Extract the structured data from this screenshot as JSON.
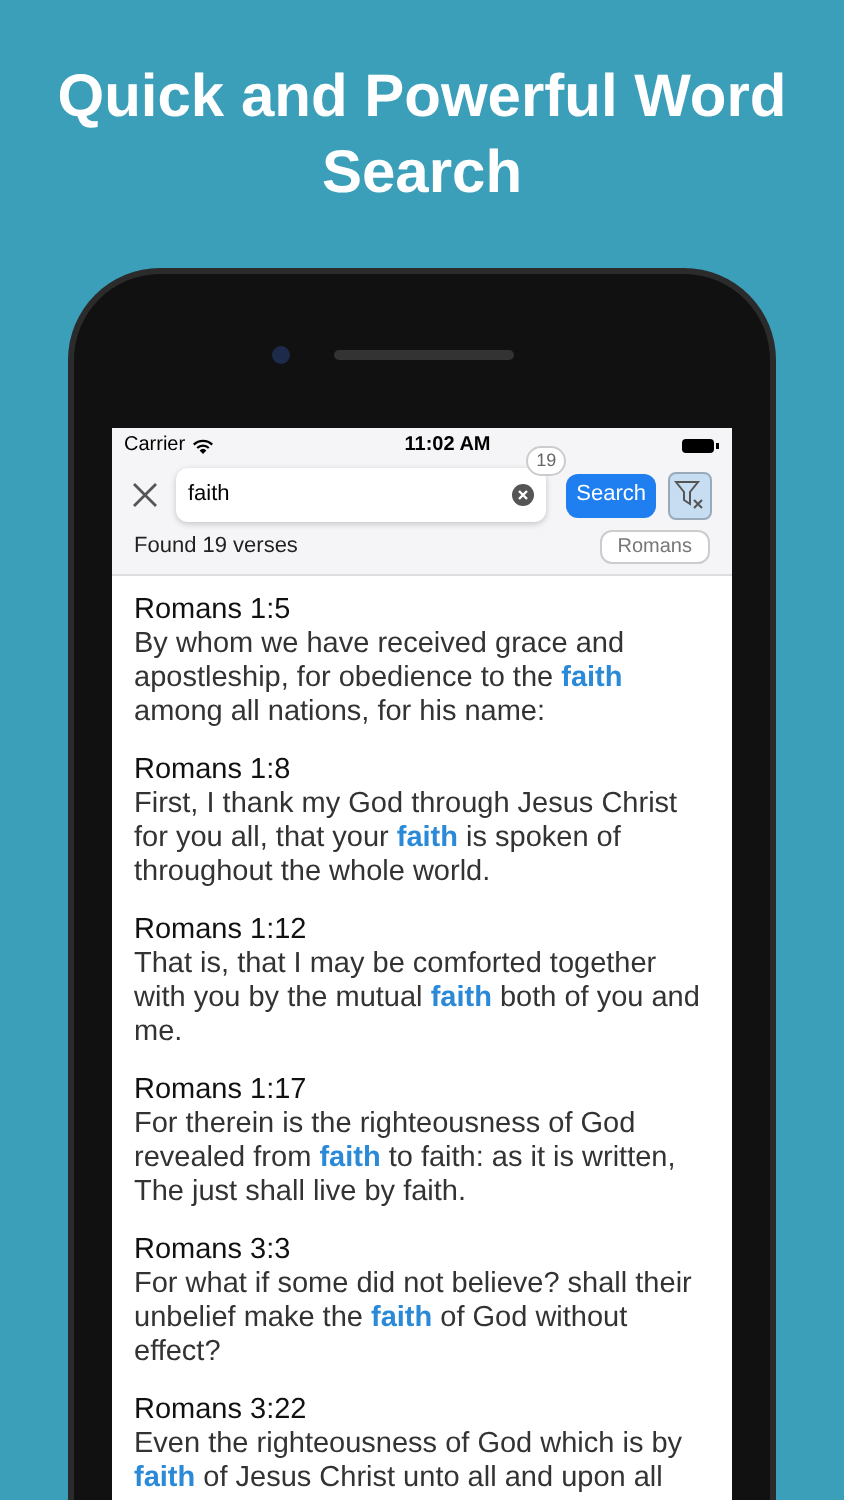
{
  "headline": "Quick and Powerful Word Search",
  "status_bar": {
    "carrier": "Carrier",
    "time": "11:02 AM"
  },
  "search": {
    "value": "faith",
    "count_badge": "19",
    "button": "Search"
  },
  "results": {
    "summary": "Found 19 verses",
    "book_filter": "Romans"
  },
  "verses": [
    {
      "reference": "Romans 1:5",
      "text": "By whom we have received grace and apostleship, for obedience to the **faith** among all nations, for his name:"
    },
    {
      "reference": "Romans 1:8",
      "text": "First, I thank my God through Jesus Christ for you all, that your **faith** is spoken of throughout the whole world."
    },
    {
      "reference": "Romans 1:12",
      "text": "That is, that I may be comforted together with you by the mutual **faith** both of you and me."
    },
    {
      "reference": "Romans 1:17",
      "text": "For therein is the righteousness of God revealed from **faith** to faith: as it is written, The just shall live by faith."
    },
    {
      "reference": "Romans 3:3",
      "text": "For what if some did not believe? shall their unbelief make the **faith** of God without effect?"
    },
    {
      "reference": "Romans 3:22",
      "text": "Even the righteousness of God which is by **faith** of Jesus Christ unto all and upon all"
    }
  ]
}
